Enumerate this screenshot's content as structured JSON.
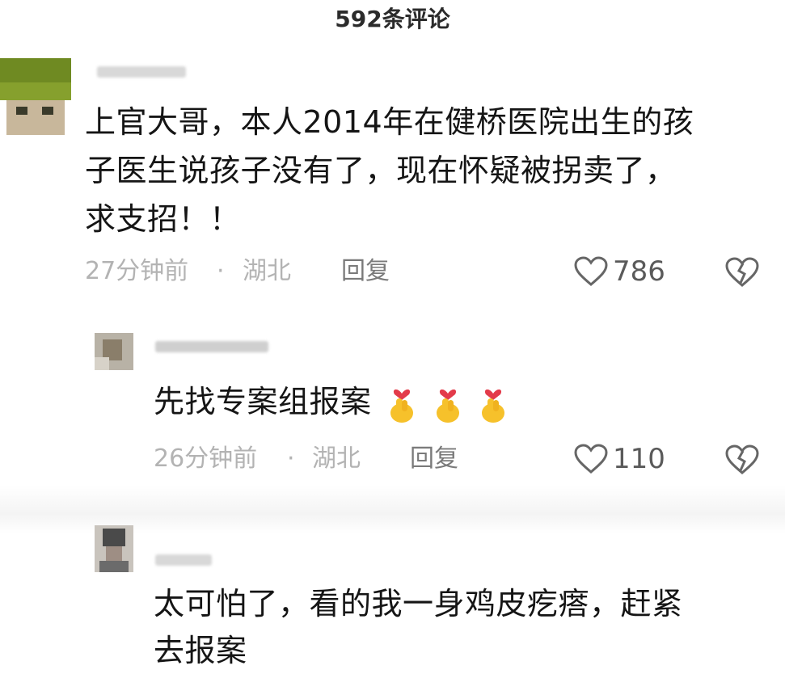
{
  "header": {
    "title": "592条评论"
  },
  "comments": [
    {
      "text_lines": [
        "上官大哥，本人2014年在健桥医院出生的孩",
        "子医生说孩子没有了，现在怀疑被拐卖了，",
        "求支招！！"
      ],
      "time": "27分钟前",
      "location": "湖北",
      "reply_label": "回复",
      "likes": "786"
    },
    {
      "text": "先找专案组报案",
      "time": "26分钟前",
      "location": "湖北",
      "reply_label": "回复",
      "likes": "110"
    },
    {
      "text_lines": [
        "太可怕了，看的我一身鸡皮疙瘩，赶紧",
        "去报案"
      ]
    }
  ],
  "meta_separator": "·",
  "icons": {
    "like": "heart-outline-icon",
    "dislike": "broken-heart-icon",
    "reaction": "finger-heart-emoji"
  },
  "colors": {
    "meta_text": "#b3b3b3",
    "body_text": "#151515",
    "emoji_yellow": "#f6c12b",
    "emoji_red": "#e33b4a"
  }
}
